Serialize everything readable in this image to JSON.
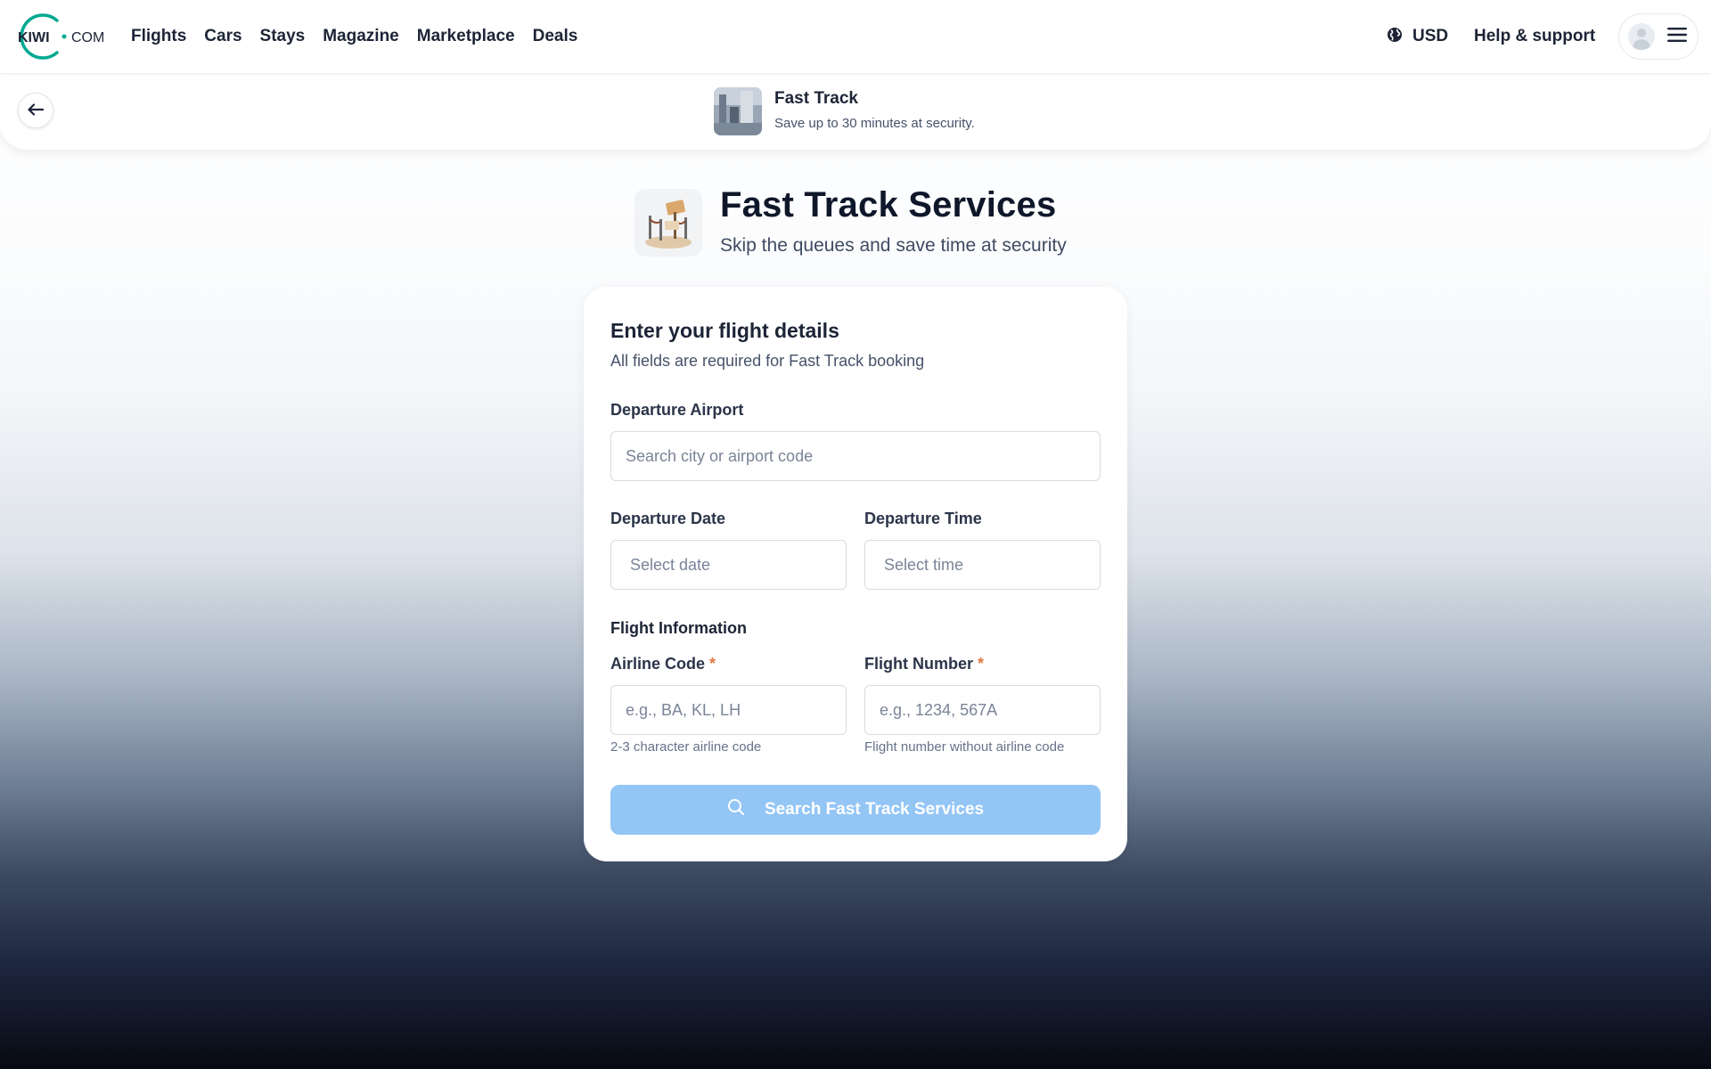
{
  "brand": {
    "logo_left": "KIWI",
    "logo_right": "COM",
    "accent": "#00a991"
  },
  "nav": {
    "links": [
      "Flights",
      "Cars",
      "Stays",
      "Magazine",
      "Marketplace",
      "Deals"
    ],
    "currency": "USD",
    "help": "Help & support"
  },
  "subheader": {
    "title": "Fast Track",
    "subtitle": "Save up to 30 minutes at security."
  },
  "hero": {
    "title": "Fast Track Services",
    "subtitle": "Skip the queues and save time at security"
  },
  "form": {
    "title": "Enter your flight details",
    "subtitle": "All fields are required for Fast Track booking",
    "departure_airport": {
      "label": "Departure Airport",
      "placeholder": "Search city or airport code",
      "value": ""
    },
    "departure_date": {
      "label": "Departure Date",
      "placeholder": "Select date",
      "value": ""
    },
    "departure_time": {
      "label": "Departure Time",
      "placeholder": "Select time",
      "value": ""
    },
    "section_label": "Flight Information",
    "airline_code": {
      "label": "Airline Code",
      "required_mark": "*",
      "placeholder": "e.g., BA, KL, LH",
      "hint": "2-3 character airline code",
      "value": ""
    },
    "flight_number": {
      "label": "Flight Number",
      "required_mark": "*",
      "placeholder": "e.g., 1234, 567A",
      "hint": "Flight number without airline code",
      "value": ""
    },
    "submit_label": "Search Fast Track Services",
    "submit_color": "#93c5f5"
  }
}
